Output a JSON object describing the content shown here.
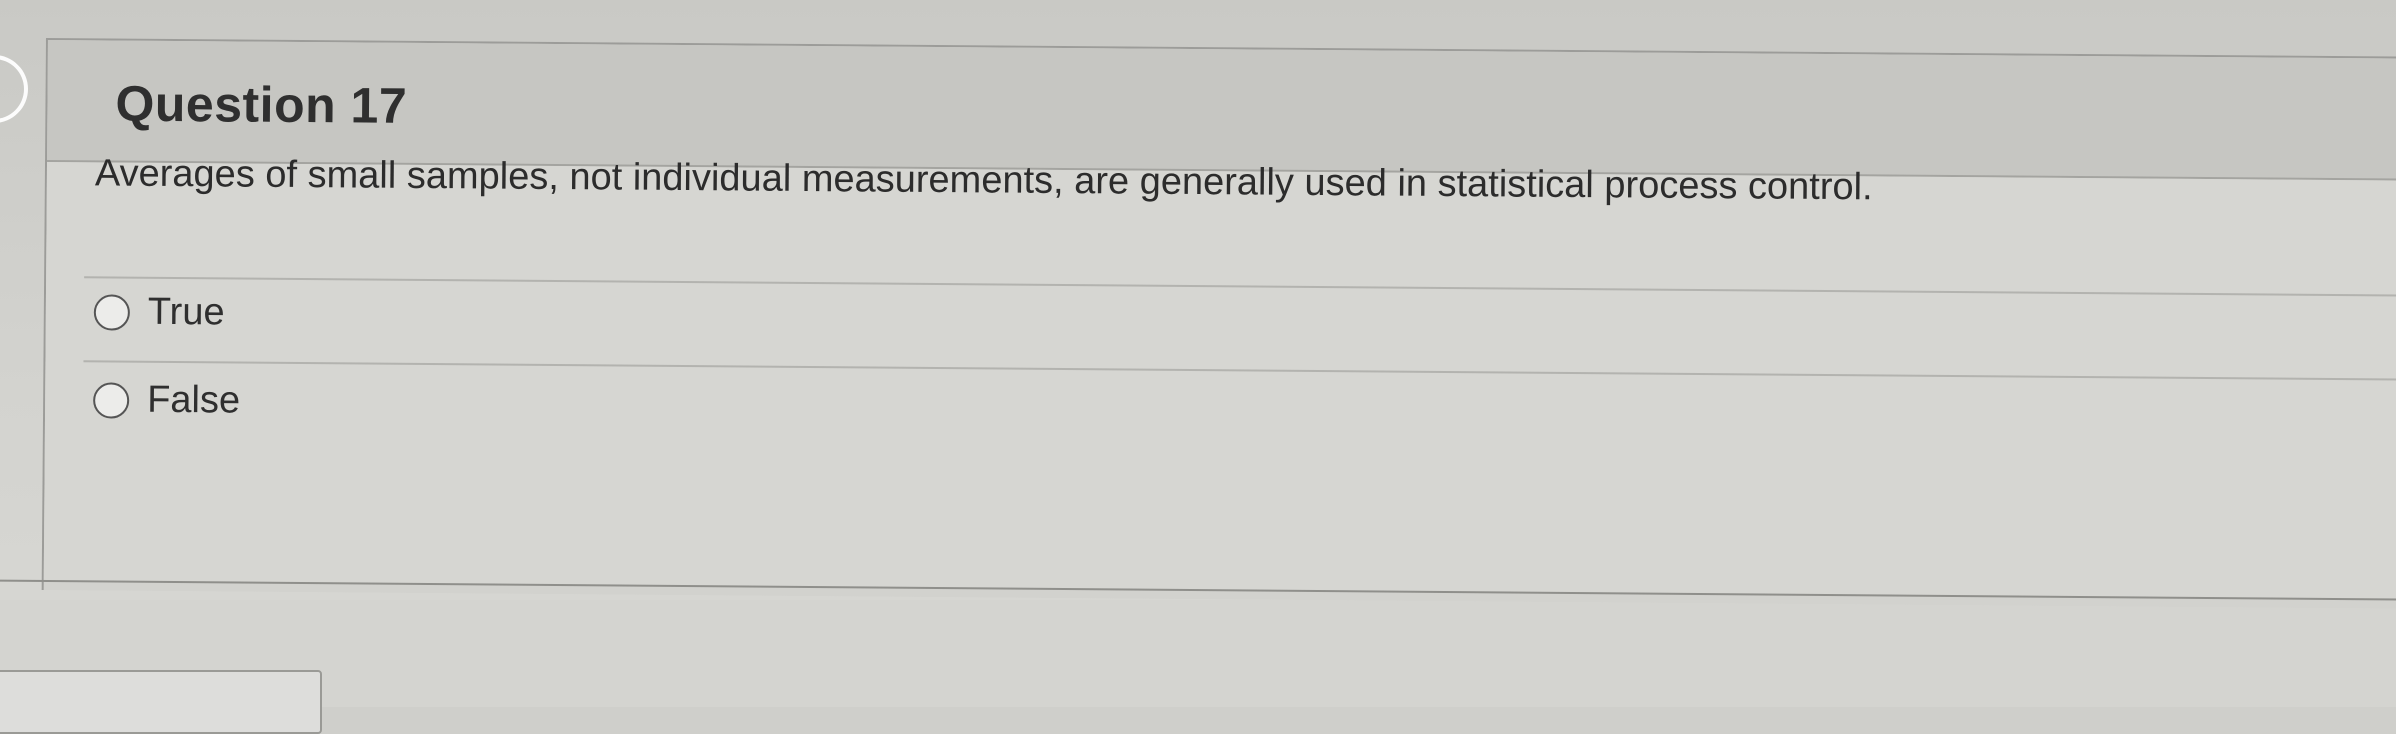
{
  "question": {
    "title": "Question 17",
    "text": "Averages of small samples, not individual measurements, are generally used in statistical process control.",
    "answers": [
      {
        "label": "True",
        "selected": false
      },
      {
        "label": "False",
        "selected": false
      }
    ]
  },
  "colors": {
    "header_bg": "#c6c6c2",
    "body_bg": "#d6d6d2",
    "text": "#2c2c2c"
  }
}
